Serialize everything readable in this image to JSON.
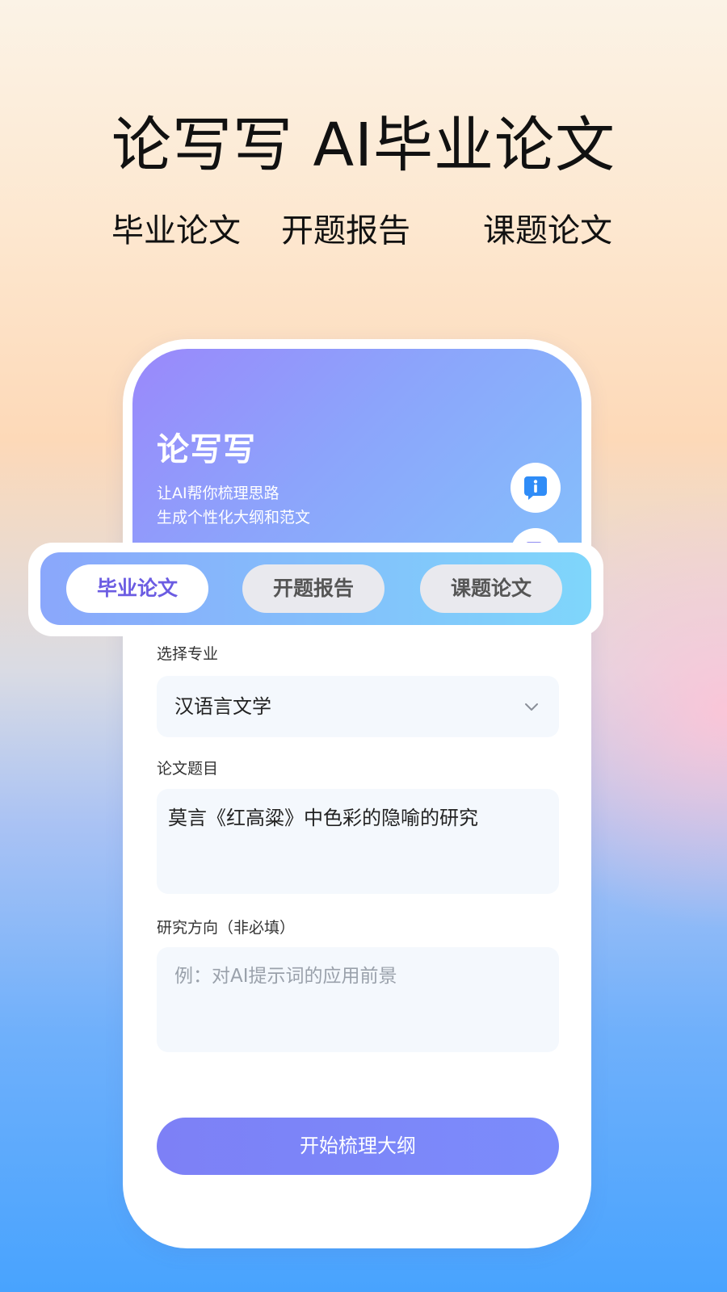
{
  "page": {
    "title": "论写写 AI毕业论文",
    "features": [
      "毕业论文",
      "开题报告",
      "课题论文"
    ]
  },
  "app": {
    "logo_text": "论写写",
    "tagline_line1": "让AI帮你梳理思路",
    "tagline_line2": "生成个性化大纲和范文",
    "action_icons": [
      "info-icon",
      "document-icon"
    ]
  },
  "tabs": [
    {
      "label": "毕业论文",
      "selected": true
    },
    {
      "label": "开题报告",
      "selected": false
    },
    {
      "label": "课题论文",
      "selected": false
    }
  ],
  "form": {
    "major": {
      "label": "选择专业",
      "value": "汉语言文学"
    },
    "topic": {
      "label": "论文题目",
      "value": "莫言《红高粱》中色彩的隐喻的研究"
    },
    "direction": {
      "label": "研究方向（非必填）",
      "placeholder": "例：对AI提示词的应用前景"
    },
    "submit_label": "开始梳理大纲"
  },
  "colors": {
    "accent": "#7b84f8",
    "tab_selected_text": "#6b5ce2",
    "icon_blue": "#2f8cf7",
    "icon_indigo": "#6c63e8"
  }
}
